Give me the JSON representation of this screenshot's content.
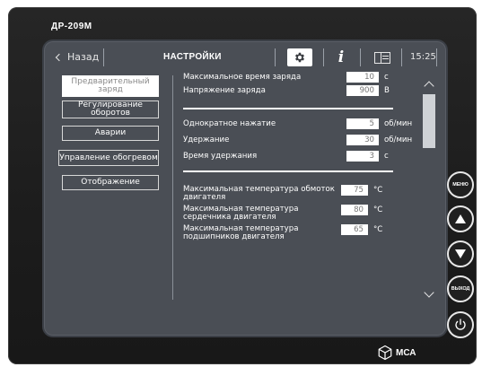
{
  "device": {
    "model": "ДР-209М",
    "brand": "МСА"
  },
  "header": {
    "back_label": "Назад",
    "title": "НАСТРОЙКИ",
    "info_glyph": "i",
    "time": "15:25",
    "icons": [
      "gear-icon",
      "info-icon",
      "panel-icon"
    ]
  },
  "menu": {
    "items": [
      {
        "label": "Предварительный заряд",
        "active": true
      },
      {
        "label": "Регулирование оборотов",
        "active": false
      },
      {
        "label": "Аварии",
        "active": false
      },
      {
        "label": "Управление обогревом",
        "active": false
      },
      {
        "label": "Отображение",
        "active": false
      }
    ]
  },
  "params": {
    "group1": [
      {
        "label": "Максимальное время заряда",
        "value": "10",
        "unit": "с"
      },
      {
        "label": "Напряжение заряда",
        "value": "900",
        "unit": "В"
      }
    ],
    "group2": [
      {
        "label": "Однократное нажатие",
        "value": "5",
        "unit": "об/мин"
      },
      {
        "label": "Удержание",
        "value": "30",
        "unit": "об/мин"
      },
      {
        "label": "Время удержания",
        "value": "3",
        "unit": "с"
      }
    ],
    "group3": [
      {
        "label": "Максимальная температура обмоток двигателя",
        "value": "75",
        "unit": "°C"
      },
      {
        "label": "Максимальная температура сердечника двигателя",
        "value": "80",
        "unit": "°C"
      },
      {
        "label": "Максимальная температура подшипников двигателя",
        "value": "65",
        "unit": "°C"
      }
    ]
  },
  "hardware_buttons": {
    "menu": "МЕНЮ",
    "up": "up-arrow-icon",
    "down": "down-arrow-icon",
    "exit": "ВЫХОД",
    "power": "power-icon"
  },
  "colors": {
    "screen_bg": "#4a4e55",
    "device_bg": "#1f1f1f",
    "accent": "#ffffff"
  }
}
